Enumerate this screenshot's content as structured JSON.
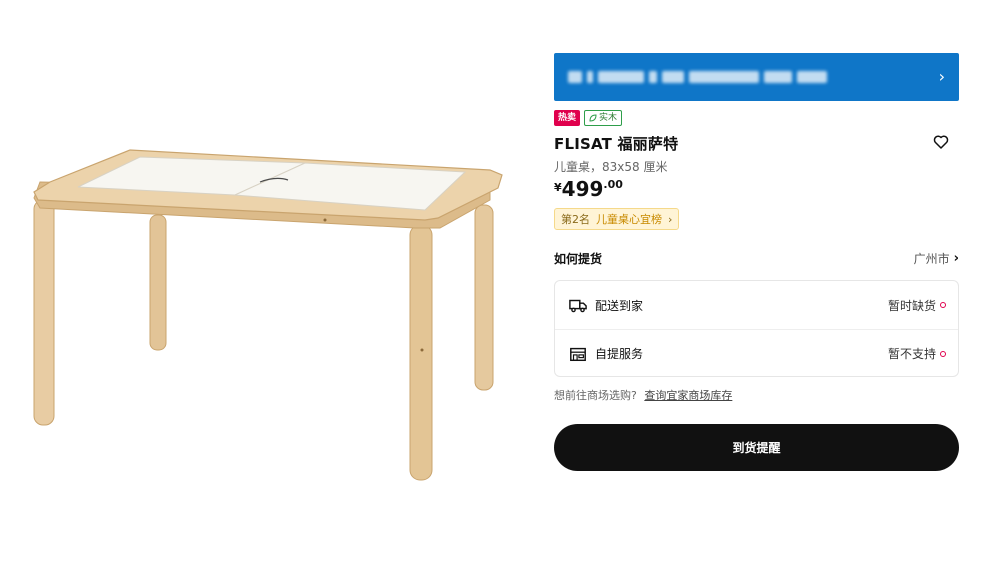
{
  "product": {
    "badges": {
      "hot": "热卖",
      "material": "实木"
    },
    "name": "FLISAT 福丽萨特",
    "description": "儿童桌，83x58 厘米",
    "price": {
      "currency": "¥",
      "integer": "499",
      "decimal": ".00"
    },
    "ranking": {
      "rank": "第2名",
      "category": "儿童桌心宜榜",
      "chevron": "›"
    }
  },
  "pickup": {
    "title": "如何提货",
    "city": "广州市",
    "options": [
      {
        "icon": "truck-icon",
        "label": "配送到家",
        "status": "暂时缺货"
      },
      {
        "icon": "store-icon",
        "label": "自提服务",
        "status": "暂不支持"
      }
    ]
  },
  "store": {
    "question": "想前往商场选购?",
    "link": "查询宜家商场库存"
  },
  "cta": {
    "label": "到货提醒"
  },
  "colors": {
    "banner": "#0f76c8",
    "hot_badge": "#e0004d",
    "material_badge": "#2e9e4a",
    "cta": "#111111",
    "ranking_bg": "#fff4d6"
  }
}
